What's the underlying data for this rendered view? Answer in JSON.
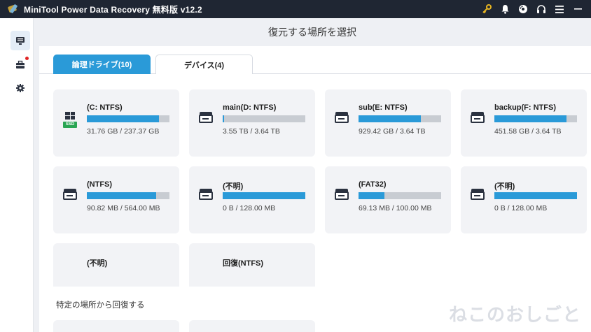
{
  "app": {
    "title": "MiniTool Power Data Recovery 無料版 v12.2"
  },
  "titlebar_icons": [
    "key-icon",
    "bell-icon",
    "disc-icon",
    "headset-icon",
    "menu-icon",
    "minimize-icon"
  ],
  "sidebar": {
    "items": [
      {
        "name": "this-pc-icon",
        "active": true
      },
      {
        "name": "toolbox-icon",
        "active": false,
        "badge": true
      },
      {
        "name": "settings-icon",
        "active": false
      }
    ]
  },
  "main": {
    "title": "復元する場所を選択",
    "tabs": [
      {
        "label": "論理ドライブ(10)",
        "active": true
      },
      {
        "label": "デバイス(4)",
        "active": false
      }
    ],
    "drives": [
      {
        "name": "(C: NTFS)",
        "size": "31.76 GB / 237.37 GB",
        "used_pct": 87,
        "icon": "windows-ssd"
      },
      {
        "name": "main(D: NTFS)",
        "size": "3.55 TB / 3.64 TB",
        "used_pct": 2,
        "icon": "drive"
      },
      {
        "name": "sub(E: NTFS)",
        "size": "929.42 GB / 3.64 TB",
        "used_pct": 75,
        "icon": "drive"
      },
      {
        "name": "backup(F: NTFS)",
        "size": "451.58 GB / 3.64 TB",
        "used_pct": 87,
        "icon": "drive"
      },
      {
        "name": "(NTFS)",
        "size": "90.82 MB / 564.00 MB",
        "used_pct": 84,
        "icon": "drive"
      },
      {
        "name": "(不明)",
        "size": "0 B / 128.00 MB",
        "used_pct": 100,
        "icon": "drive"
      },
      {
        "name": "(FAT32)",
        "size": "69.13 MB / 100.00 MB",
        "used_pct": 31,
        "icon": "drive"
      },
      {
        "name": "(不明)",
        "size": "0 B / 128.00 MB",
        "used_pct": 100,
        "icon": "drive"
      },
      {
        "name": "(不明)",
        "size": "",
        "used_pct": null,
        "icon": "none"
      },
      {
        "name": "回復(NTFS)",
        "size": "",
        "used_pct": null,
        "icon": "none"
      }
    ]
  },
  "specific_location": {
    "title": "特定の場所から回復する"
  },
  "watermark": "ねこのおしごと",
  "colors": {
    "accent": "#2a9ad8",
    "titlebar": "#1f2633",
    "ssd_badge": "#2aa654",
    "ssd_label": "SSD"
  }
}
